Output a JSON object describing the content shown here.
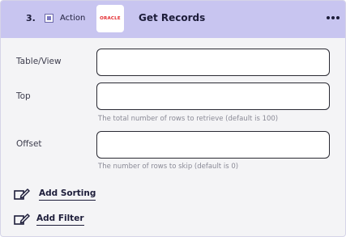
{
  "header": {
    "step_number": "3.",
    "step_type": "Action",
    "connector_logo": "ORACLE",
    "title": "Get Records",
    "more_icon": "more-horizontal-icon"
  },
  "fields": {
    "table_view": {
      "label": "Table/View",
      "value": "",
      "hint": ""
    },
    "top": {
      "label": "Top",
      "value": "",
      "hint": "The total number of rows to retrieve (default is 100)"
    },
    "offset": {
      "label": "Offset",
      "value": "",
      "hint": "The number of rows to skip (default is 0)"
    }
  },
  "actions": {
    "sorting": {
      "label": "Add Sorting",
      "icon": "edit-icon"
    },
    "filter": {
      "label": "Add Filter",
      "icon": "edit-icon"
    }
  },
  "colors": {
    "header_bg": "#c8c5f0",
    "card_bg": "#f4f4f6",
    "brand_red": "#e3272b"
  }
}
